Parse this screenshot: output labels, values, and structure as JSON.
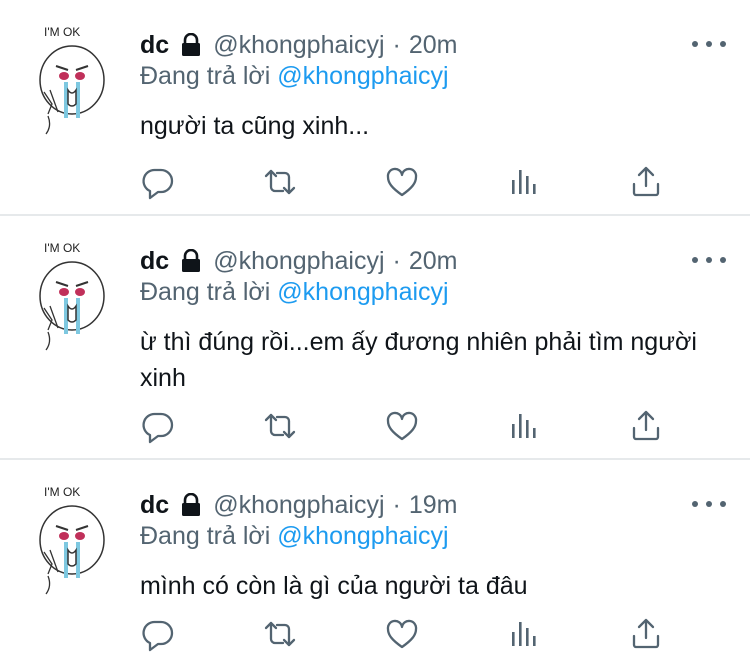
{
  "tweets": [
    {
      "name": "dc",
      "handle": "@khongphaicyj",
      "separator": "·",
      "time": "20m",
      "replying_prefix": "Đang trả lời ",
      "replying_to": "@khongphaicyj",
      "text": "người ta cũng xinh...",
      "avatar_caption": "I'M OK"
    },
    {
      "name": "dc",
      "handle": "@khongphaicyj",
      "separator": "·",
      "time": "20m",
      "replying_prefix": "Đang trả lời ",
      "replying_to": "@khongphaicyj",
      "text": "ừ thì đúng rồi...em ấy đương nhiên phải tìm người xinh",
      "avatar_caption": "I'M OK"
    },
    {
      "name": "dc",
      "handle": "@khongphaicyj",
      "separator": "·",
      "time": "19m",
      "replying_prefix": "Đang trả lời ",
      "replying_to": "@khongphaicyj",
      "text": "mình có còn là gì của người ta đâu",
      "avatar_caption": "I'M OK"
    }
  ],
  "icons": {
    "reply": "reply-icon",
    "retweet": "retweet-icon",
    "like": "like-icon",
    "analytics": "analytics-icon",
    "share": "share-icon",
    "lock": "lock-icon",
    "more": "more-icon"
  },
  "colors": {
    "text": "#0f1419",
    "secondary": "#536471",
    "link": "#1d9bf0",
    "divider": "#e6e9eb"
  }
}
